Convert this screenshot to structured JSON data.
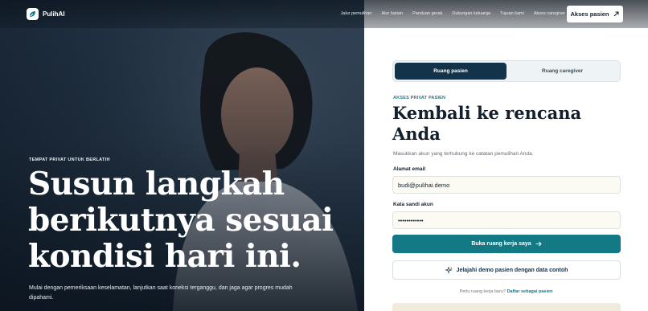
{
  "brand": {
    "name": "PulihAI"
  },
  "nav": {
    "links": [
      "Jalur pemulihan",
      "Alur harian",
      "Panduan gerak",
      "Dukungan keluarga",
      "Tujuan kami",
      "Akses caregiver"
    ],
    "cta_label": "Akses pasien",
    "cta_icon": "arrow-up-right-icon"
  },
  "hero": {
    "eyebrow": "TEMPAT PRIVAT UNTUK BERLATIH",
    "title": "Susun langkah berikutnya sesuai kondisi hari ini.",
    "description": "Mulai dengan pemeriksaan keselamatan, lanjutkan saat koneksi terganggu, dan jaga agar progres mudah dipahami."
  },
  "login": {
    "tabs": [
      {
        "label": "Ruang pasien",
        "active": true
      },
      {
        "label": "Ruang caregiver",
        "active": false
      }
    ],
    "eyebrow": "AKSES PRIVAT PASIEN",
    "heading": "Kembali ke rencana Anda",
    "subtext": "Masukkan akun yang terhubung ke catatan pemulihan Anda.",
    "email_label": "Alamat email",
    "email_value": "budi@pulihai.demo",
    "password_label": "Kata sandi akun",
    "password_value": "demo1234abcd",
    "submit_label": "Buka ruang kerja saya",
    "submit_icon": "arrow-right-icon",
    "demo_label": "Jelajahi demo pasien dengan data contoh",
    "demo_icon": "sparkles-icon",
    "signup_prompt": "Perlu ruang kerja baru?",
    "signup_link": "Daftar sebagai pasien"
  },
  "colors": {
    "primary": "#137a85",
    "navy": "#13334a",
    "field_bg": "#fbfaf3"
  }
}
